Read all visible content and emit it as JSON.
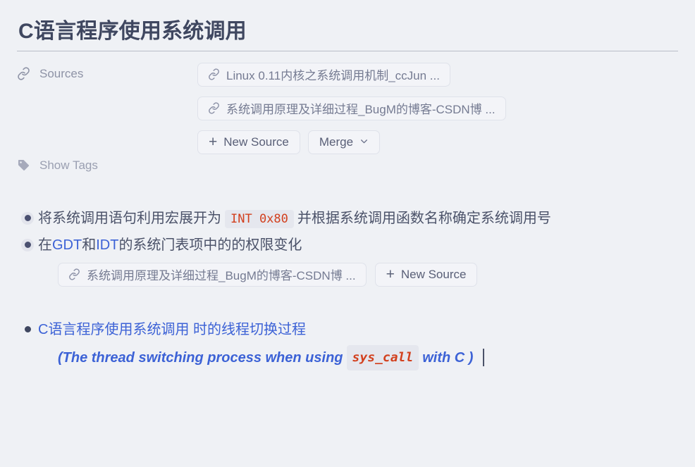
{
  "document": {
    "title": "C语言程序使用系统调用"
  },
  "sources": {
    "label": "Sources",
    "icon": "link-icon",
    "chips": [
      {
        "icon": "link-icon",
        "text": "Linux 0.11内核之系统调用机制_ccJun ..."
      },
      {
        "icon": "link-icon",
        "text": "系统调用原理及详细过程_BugM的博客-CSDN博 ..."
      }
    ],
    "new_source_label": "New Source",
    "new_source_plus": "+",
    "merge_label": "Merge",
    "merge_caret": "⌄"
  },
  "tags": {
    "icon": "tag-icon",
    "label": "Show Tags"
  },
  "bullets": [
    {
      "bullet_style": "halo",
      "prefix": "将系统调用语句利用宏展开为",
      "code": "INT 0x80",
      "suffix": "并根据系统调用函数名称确定系统调用号"
    },
    {
      "bullet_style": "halo",
      "part1": "在",
      "link1": "GDT",
      "part2": "和",
      "link2": "IDT",
      "part3": "的系统门表项中的的权限变化",
      "sub_source": {
        "icon": "link-icon",
        "text": "系统调用原理及详细过程_BugM的博客-CSDN博 ...",
        "new_source_plus": "+",
        "new_source_label": "New Source"
      }
    }
  ],
  "final_bullet": {
    "bullet_style": "plain",
    "line1": "C语言程序使用系统调用 时的线程切换过程",
    "line2_prefix": "(The thread switching process when using",
    "line2_code": "sys_call",
    "line2_suffix": "with C )"
  },
  "colors": {
    "background": "#eff1f5",
    "title": "#3f4760",
    "body_text": "#4b5269",
    "muted_label": "#8e93a6",
    "link_blue": "#3c62d6",
    "code_red": "#d2401e",
    "code_bg": "#e5e7ee",
    "chip_border": "#dfe2ea",
    "rule": "#b9bdc7"
  }
}
